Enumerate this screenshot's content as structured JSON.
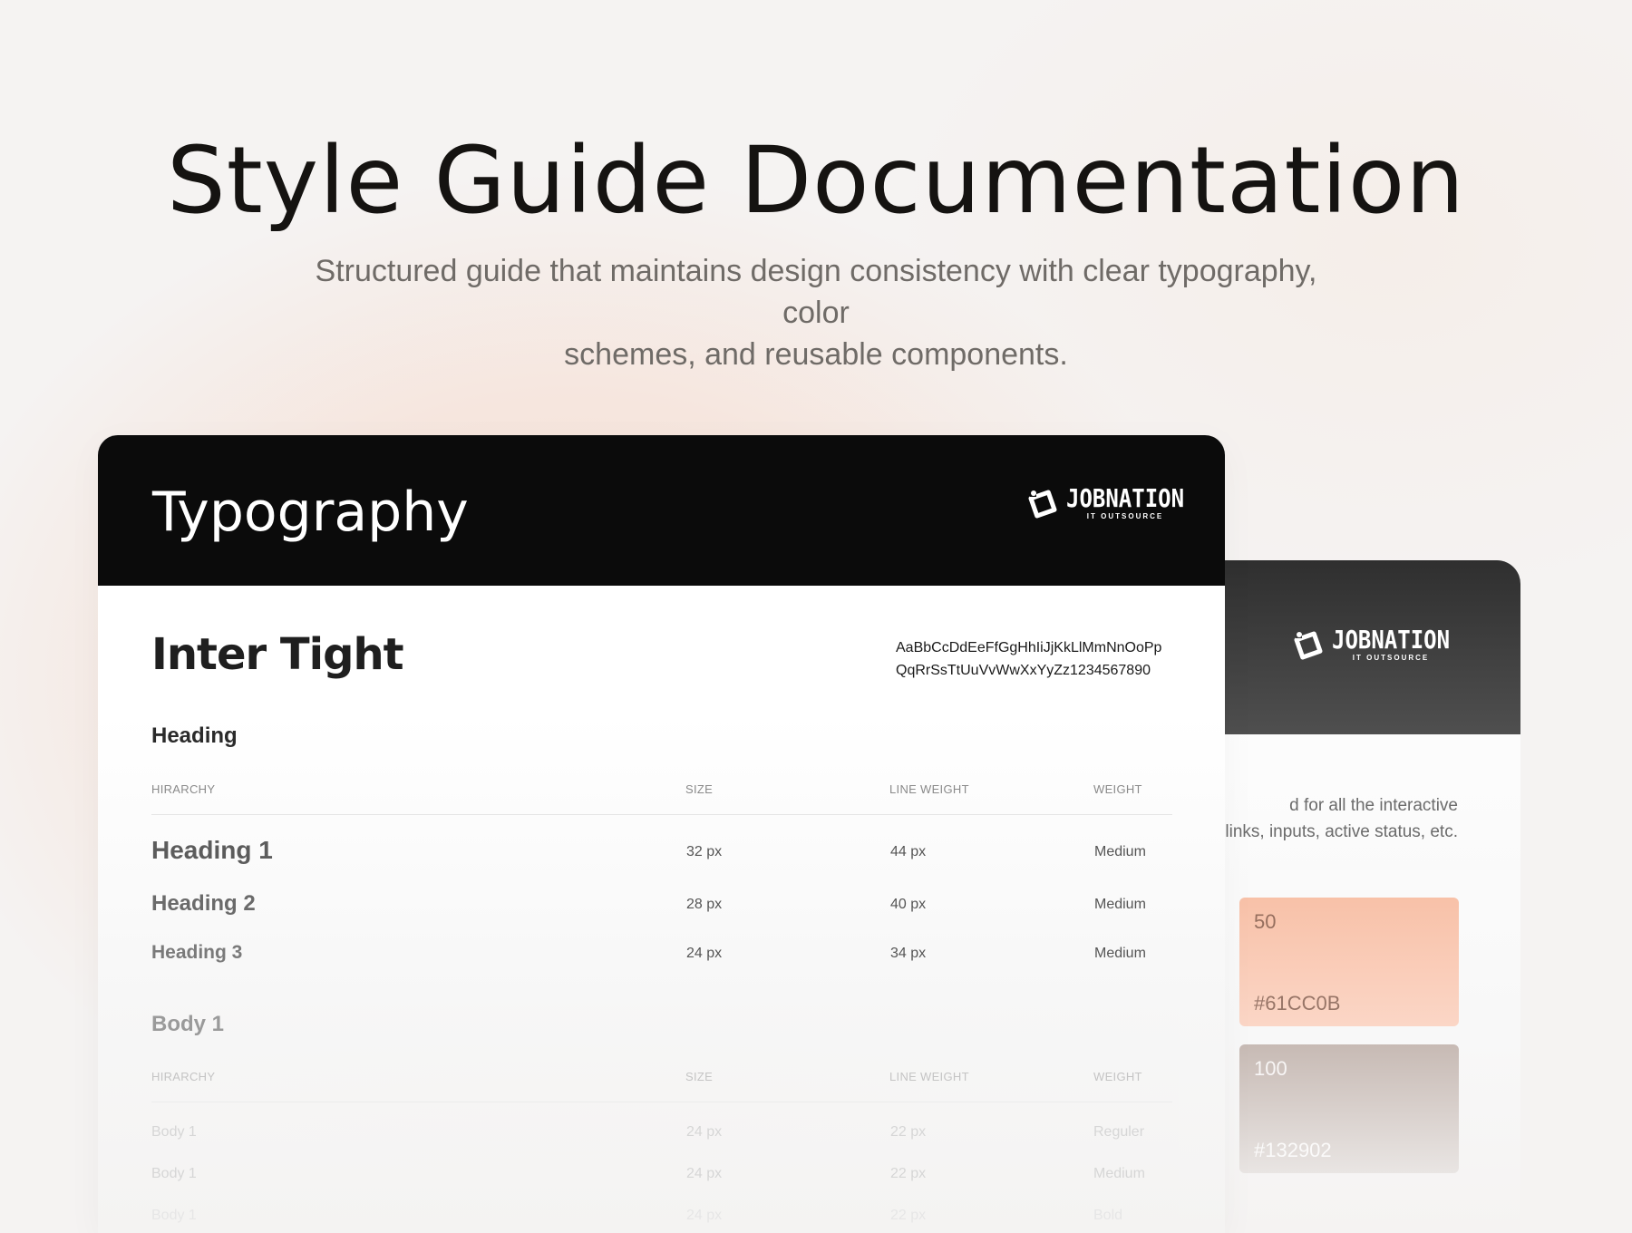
{
  "hero": {
    "title": "Style Guide Documentation",
    "subtitle_line1": "Structured guide that maintains design consistency with clear typography, color",
    "subtitle_line2": "schemes, and reusable components."
  },
  "brand": {
    "name": "JOBNATION",
    "tagline": "IT OUTSOURCE"
  },
  "typography": {
    "title": "Typography",
    "font_name": "Inter Tight",
    "glyphs_line1": "AaBbCcDdEeFfGgHhIiJjKkLlMmNnOoPp",
    "glyphs_line2": "QqRrSsTtUuVvWwXxYyZz1234567890",
    "columns": [
      "HIRARCHY",
      "SIZE",
      "LINE WEIGHT",
      "WEIGHT"
    ],
    "heading_section": {
      "label": "Heading",
      "rows": [
        {
          "name": "Heading 1",
          "size": "32 px",
          "line": "44 px",
          "weight": "Medium"
        },
        {
          "name": "Heading 2",
          "size": "28 px",
          "line": "40 px",
          "weight": "Medium"
        },
        {
          "name": "Heading 3",
          "size": "24 px",
          "line": "34 px",
          "weight": "Medium"
        }
      ]
    },
    "body_section": {
      "label": "Body 1",
      "rows": [
        {
          "name": "Body 1",
          "size": "24 px",
          "line": "22 px",
          "weight": "Reguler"
        },
        {
          "name": "Body 1",
          "size": "24 px",
          "line": "22 px",
          "weight": "Medium"
        },
        {
          "name": "Body 1",
          "size": "24 px",
          "line": "22 px",
          "weight": "Bold"
        }
      ]
    }
  },
  "colors": {
    "desc_line1": "d for all the interactive",
    "desc_line2": "links, inputs, active status, etc.",
    "swatches": [
      {
        "level": "50",
        "hex": "#61CC0B",
        "color": "#f8c1a8"
      },
      {
        "level": "100",
        "hex": "#132902",
        "color": "#c7bab4"
      }
    ]
  }
}
